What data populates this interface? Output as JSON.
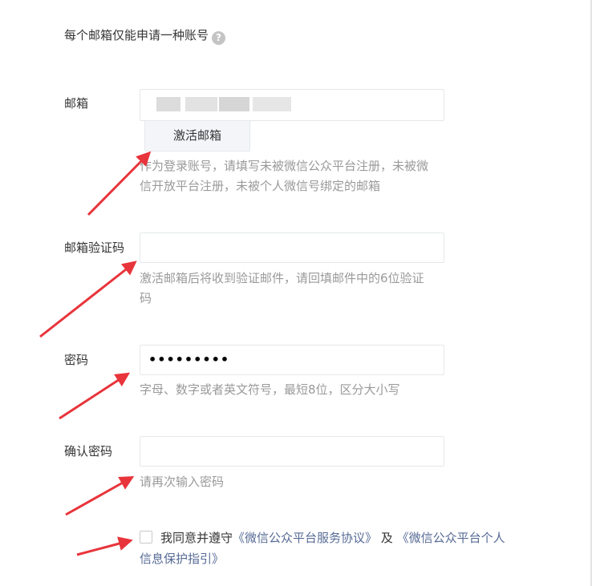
{
  "notice": {
    "text": "每个邮箱仅能申请一种账号",
    "help_glyph": "?"
  },
  "email": {
    "label": "邮箱",
    "value": "",
    "activate_label": "激活邮箱",
    "hint": "作为登录账号，请填写未被微信公众平台注册，未被微信开放平台注册，未被个人微信号绑定的邮箱"
  },
  "email_code": {
    "label": "邮箱验证码",
    "value": "",
    "hint": "激活邮箱后将收到验证邮件，请回填邮件中的6位验证码"
  },
  "password": {
    "label": "密码",
    "masked_value": "•••••••••",
    "hint": "字母、数字或者英文符号，最短8位，区分大小写"
  },
  "confirm_password": {
    "label": "确认密码",
    "value": "",
    "hint": "请再次输入密码"
  },
  "agreement": {
    "checked": false,
    "prefix": "我同意并遵守",
    "link1": "《微信公众平台服务协议》",
    "middle": " 及 ",
    "link2_part1": "《微信公众平台个人",
    "link2_part2": "信息保护指引》"
  },
  "colors": {
    "arrow": "#e8343b",
    "hint": "#9a9a9a",
    "link": "#576b95",
    "border": "#e4e8eb"
  }
}
